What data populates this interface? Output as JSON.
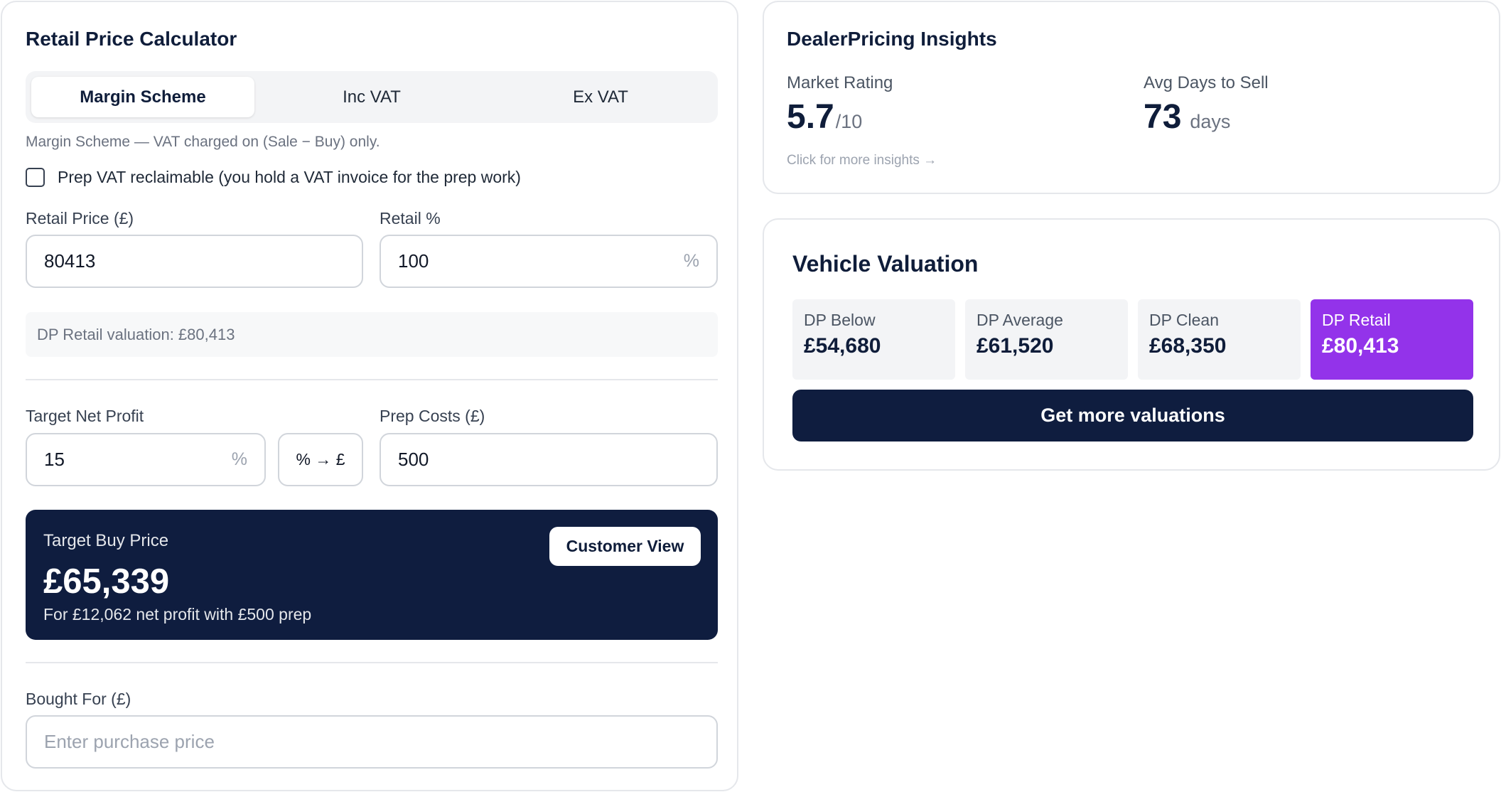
{
  "calculator": {
    "title": "Retail Price Calculator",
    "tabs": [
      {
        "label": "Margin Scheme",
        "active": true
      },
      {
        "label": "Inc VAT",
        "active": false
      },
      {
        "label": "Ex VAT",
        "active": false
      }
    ],
    "scheme_note": "Margin Scheme — VAT charged on (Sale − Buy) only.",
    "prep_vat_checkbox": {
      "label": "Prep VAT reclaimable (you hold a VAT invoice for the prep work)",
      "checked": false
    },
    "retail_price": {
      "label": "Retail Price (£)",
      "value": "80413"
    },
    "retail_percent": {
      "label": "Retail %",
      "value": "100",
      "suffix": "%"
    },
    "dp_retail_info": "DP Retail valuation: £80,413",
    "target_net_profit": {
      "label": "Target Net Profit",
      "value": "15",
      "suffix": "%"
    },
    "convert_button": "% → £",
    "prep_costs": {
      "label": "Prep Costs (£)",
      "value": "500"
    },
    "result": {
      "label": "Target Buy Price",
      "value": "£65,339",
      "subtext": "For £12,062 net profit with £500 prep",
      "customer_view_button": "Customer View"
    },
    "bought_for": {
      "label": "Bought For (£)",
      "value": "",
      "placeholder": "Enter purchase price"
    }
  },
  "insights": {
    "title": "DealerPricing Insights",
    "market_rating": {
      "label": "Market Rating",
      "value": "5.7",
      "unit": "/10"
    },
    "avg_days": {
      "label": "Avg Days to Sell",
      "value": "73",
      "unit": "days"
    },
    "link": "Click for more insights →"
  },
  "valuation": {
    "title": "Vehicle Valuation",
    "tiles": [
      {
        "label": "DP Below",
        "value": "£54,680"
      },
      {
        "label": "DP Average",
        "value": "£61,520"
      },
      {
        "label": "DP Clean",
        "value": "£68,350"
      },
      {
        "label": "DP Retail",
        "value": "£80,413"
      }
    ],
    "button": "Get more valuations"
  },
  "colors": {
    "navy": "#0f1d3f",
    "accent_purple": "#9333ea",
    "border": "#e5e7eb"
  }
}
